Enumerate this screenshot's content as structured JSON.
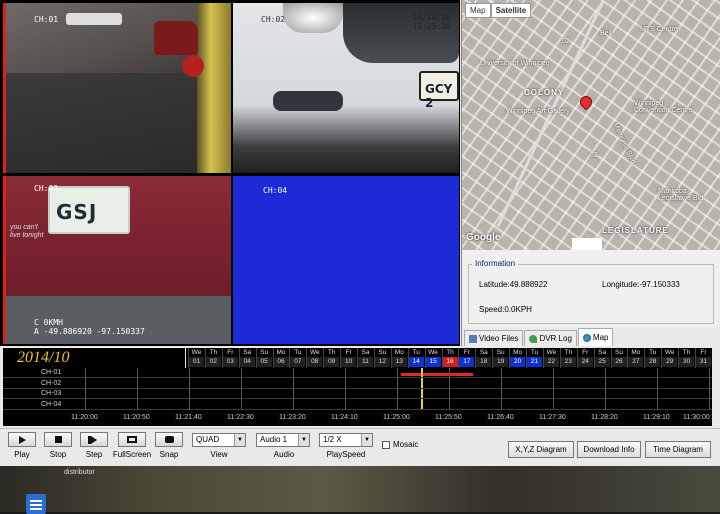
{
  "cameras": [
    {
      "label": "CH:01"
    },
    {
      "label": "CH:02",
      "timestamp_date": "14/10/16",
      "timestamp_time": "11:25:30",
      "plate": "GCY 2"
    },
    {
      "label": "CH:03",
      "plate": "GSJ",
      "sticker": "you can't\nlive tonight",
      "overlay_speed": "C 0KMH",
      "overlay_coords": "A -49.886920 -97.150337"
    },
    {
      "label": "CH:04"
    }
  ],
  "map": {
    "tabs": [
      "Map",
      "Satellite"
    ],
    "active_tab": "Satellite",
    "labels": {
      "university": "University of Winnipeg",
      "colony": "COLONY",
      "art_gallery": "Winnipeg Art Gallery",
      "convention": "Winnipeg\nConvention Centre",
      "mts": "MTS Centre",
      "bell": "Bell",
      "memorial": "Memorial Blvd",
      "legislature": "LEGISLATURE",
      "manitoba": "Manitoba\nLegislative Bld",
      "road_62": "62",
      "road_52": "52"
    },
    "logo": "Google"
  },
  "info": {
    "title": "Information",
    "latitude": "Latitude:49.888922",
    "longitude": "Longitude:-97.150333",
    "speed": "Speed:0.0KPH"
  },
  "panel_tabs": [
    {
      "label": "Video Files",
      "icon": "video-icon"
    },
    {
      "label": "DVR Log",
      "icon": "log-icon"
    },
    {
      "label": "Map",
      "icon": "globe-icon",
      "active": true
    }
  ],
  "calendar": {
    "month_label": "2014/10",
    "day_names": [
      "We",
      "Th",
      "Fr",
      "Sa",
      "Su",
      "Mo",
      "Tu",
      "We",
      "Th",
      "Fr",
      "Sa",
      "Su",
      "Mo",
      "Tu",
      "We",
      "Th",
      "Fr",
      "Sa",
      "Su",
      "Mo",
      "Tu",
      "We",
      "Th",
      "Fr",
      "Sa",
      "Su",
      "Mo",
      "Tu",
      "We",
      "Th",
      "Fr"
    ],
    "day_numbers": [
      "01",
      "02",
      "03",
      "04",
      "05",
      "06",
      "07",
      "08",
      "09",
      "10",
      "11",
      "12",
      "13",
      "14",
      "15",
      "16",
      "17",
      "18",
      "19",
      "20",
      "21",
      "22",
      "23",
      "24",
      "25",
      "26",
      "27",
      "28",
      "29",
      "30",
      "31"
    ],
    "highlighted": [
      "14",
      "15",
      "17",
      "20",
      "21"
    ],
    "selected": "16"
  },
  "channels": [
    "CH-01",
    "CH-02",
    "CH-03",
    "CH-04"
  ],
  "time_ticks": [
    "11:20:00",
    "11:20:50",
    "11:21:40",
    "11:22:30",
    "11:23:20",
    "11:24:10",
    "11:25:00",
    "11:25:50",
    "11:26:40",
    "11:27:30",
    "11:28:20",
    "11:29:10",
    "11:30:00"
  ],
  "controls": {
    "buttons": [
      {
        "label": "Play",
        "icon": "play-icon"
      },
      {
        "label": "Stop",
        "icon": "stop-icon"
      },
      {
        "label": "Step",
        "icon": "step-icon"
      },
      {
        "label": "FullScreen",
        "icon": "fullscreen-icon"
      },
      {
        "label": "Snap",
        "icon": "camera-icon"
      }
    ],
    "view": {
      "value": "QUAD",
      "label": "View"
    },
    "audio": {
      "value": "Audio 1",
      "label": "Audio"
    },
    "playspeed": {
      "value": "1/2 X",
      "label": "PlaySpeed"
    },
    "mosaic": "Mosaic",
    "actions": [
      "X,Y,Z Diagram",
      "Download Info",
      "Time Diagram"
    ]
  },
  "desktop": {
    "text": "distributor"
  }
}
